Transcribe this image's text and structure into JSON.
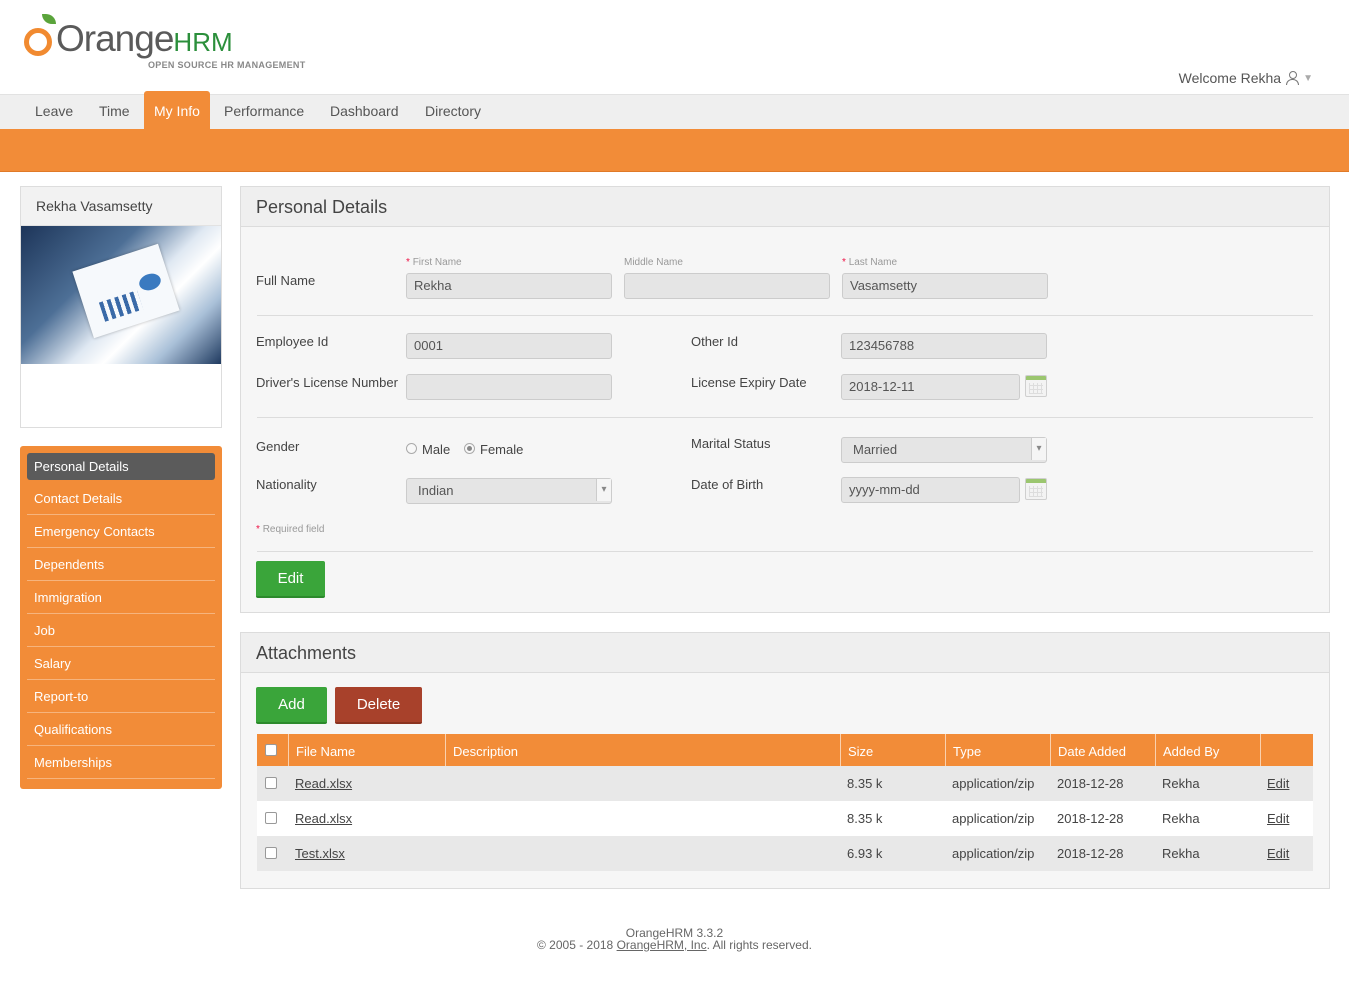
{
  "brand": {
    "logo_text": "Orange",
    "logo_text_suffix": "HRM",
    "tagline": "OPEN SOURCE HR MANAGEMENT"
  },
  "user": {
    "welcome": "Welcome Rekha"
  },
  "nav": [
    "Leave",
    "Time",
    "My Info",
    "Performance",
    "Dashboard",
    "Directory"
  ],
  "profile": {
    "name": "Rekha Vasamsetty"
  },
  "sidemenu": [
    "Personal Details",
    "Contact Details",
    "Emergency Contacts",
    "Dependents",
    "Immigration",
    "Job",
    "Salary",
    "Report-to",
    "Qualifications",
    "Memberships"
  ],
  "personal": {
    "title": "Personal Details",
    "full_name_label": "Full Name",
    "first_name_label": "First Name",
    "middle_name_label": "Middle Name",
    "last_name_label": "Last Name",
    "required_mark": "*",
    "first_name": "Rekha",
    "middle_name": "",
    "last_name": "Vasamsetty",
    "employee_id_label": "Employee Id",
    "employee_id": "0001",
    "other_id_label": "Other Id",
    "other_id": "123456788",
    "license_label": "Driver's License Number",
    "license": "",
    "license_expiry_label": "License Expiry Date",
    "license_expiry": "2018-12-11",
    "gender_label": "Gender",
    "gender_male": "Male",
    "gender_female": "Female",
    "gender_selected": "Female",
    "marital_label": "Marital Status",
    "marital": "Married",
    "nationality_label": "Nationality",
    "nationality": "Indian",
    "dob_label": "Date of Birth",
    "dob": "yyyy-mm-dd",
    "required_note": "Required field",
    "edit_button": "Edit"
  },
  "attachments": {
    "title": "Attachments",
    "add_button": "Add",
    "delete_button": "Delete",
    "columns": [
      "File Name",
      "Description",
      "Size",
      "Type",
      "Date Added",
      "Added By"
    ],
    "rows": [
      {
        "file": "Read.xlsx",
        "description": "",
        "size": "8.35 k",
        "type": "application/zip",
        "date": "2018-12-28",
        "by": "Rekha",
        "action": "Edit"
      },
      {
        "file": "Read.xlsx",
        "description": "",
        "size": "8.35 k",
        "type": "application/zip",
        "date": "2018-12-28",
        "by": "Rekha",
        "action": "Edit"
      },
      {
        "file": "Test.xlsx",
        "description": "",
        "size": "6.93 k",
        "type": "application/zip",
        "date": "2018-12-28",
        "by": "Rekha",
        "action": "Edit"
      }
    ]
  },
  "footer": {
    "version": "OrangeHRM 3.3.2",
    "copyright_prefix": "© 2005 - 2018 ",
    "company_link": "OrangeHRM, Inc",
    "copyright_suffix": ". All rights reserved."
  }
}
